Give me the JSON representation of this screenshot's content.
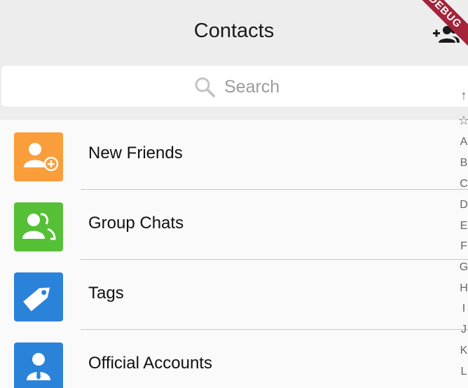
{
  "header": {
    "title": "Contacts"
  },
  "debug_banner": "DEBUG",
  "search": {
    "placeholder": "Search"
  },
  "rows": [
    {
      "label": "New Friends",
      "color": "#fa9d3b"
    },
    {
      "label": "Group Chats",
      "color": "#55c036"
    },
    {
      "label": "Tags",
      "color": "#2b82d9"
    },
    {
      "label": "Official Accounts",
      "color": "#2b82d9"
    }
  ],
  "index_bar": [
    "↑",
    "☆",
    "A",
    "B",
    "C",
    "D",
    "E",
    "F",
    "G",
    "H",
    "I",
    "J",
    "K",
    "L"
  ]
}
